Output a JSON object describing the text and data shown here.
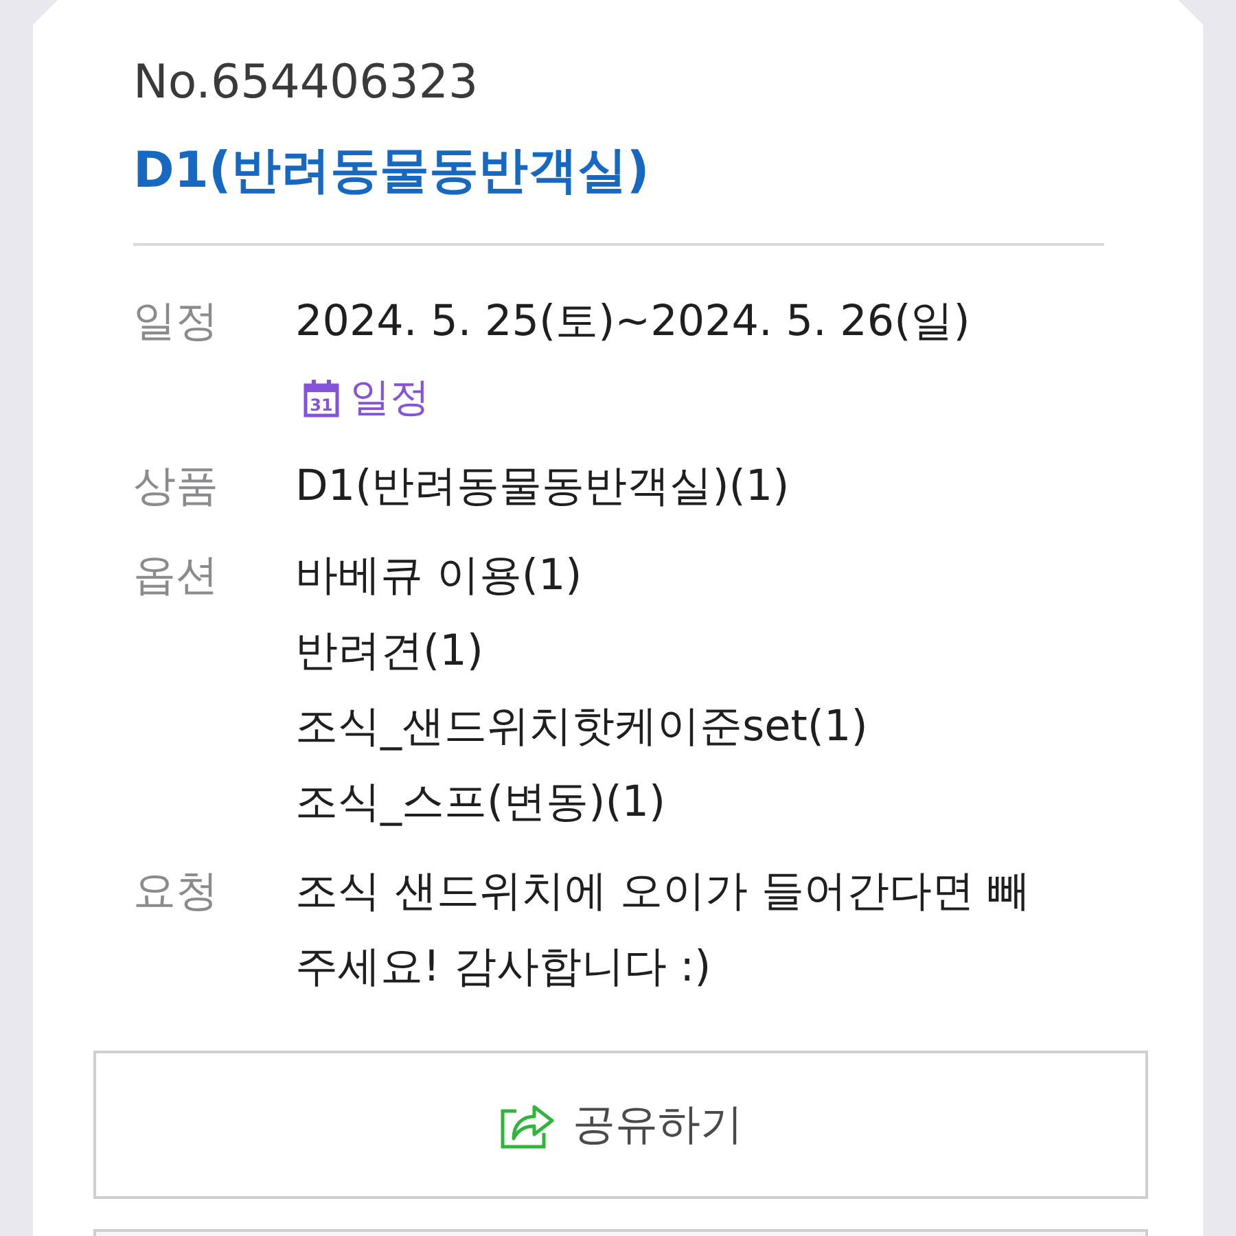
{
  "order": {
    "number": "No.654406323",
    "title": "D1(반려동물동반객실)"
  },
  "details": [
    {
      "label": "일정",
      "lines": [
        "2024. 5. 25(토)~2024. 5. 26(일)"
      ],
      "link": {
        "calendar_day": "31",
        "text": "일정"
      }
    },
    {
      "label": "상품",
      "lines": [
        "D1(반려동물동반객실)(1)"
      ]
    },
    {
      "label": "옵션",
      "lines": [
        "바베큐 이용(1)",
        "반려견(1)",
        "조식_샌드위치핫케이준set(1)",
        "조식_스프(변동)(1)"
      ]
    },
    {
      "label": "요청",
      "lines": [
        "조식 샌드위치에 오이가 들어간다면 빼 주세요! 감사합니다 :)"
      ]
    }
  ],
  "share_button": {
    "label": "공유하기"
  }
}
